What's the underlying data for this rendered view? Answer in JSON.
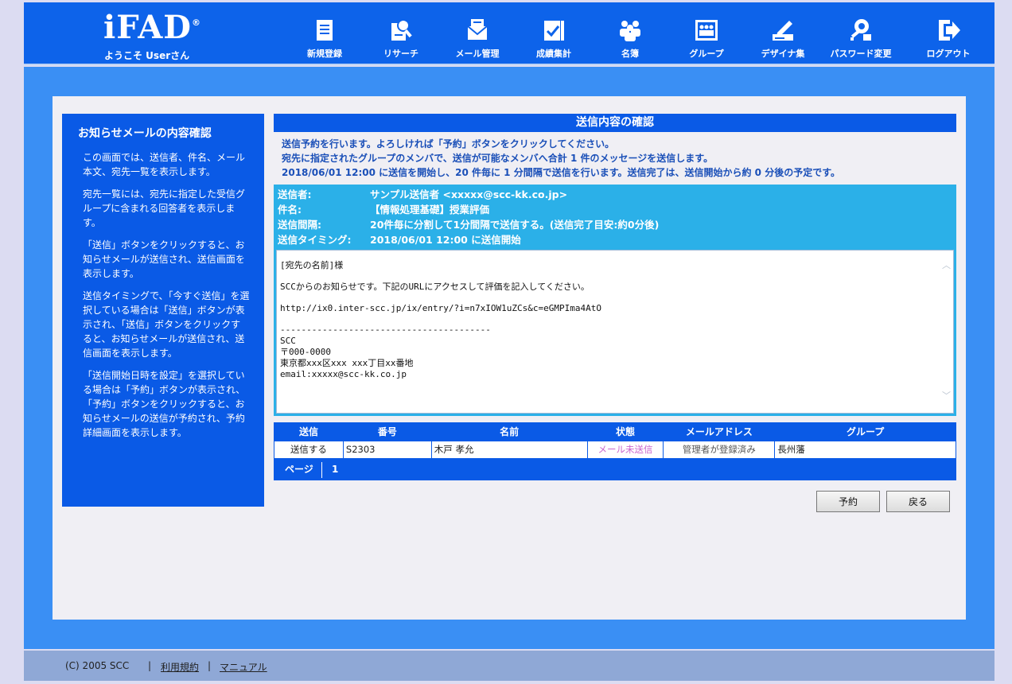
{
  "header": {
    "logo": "iFAD",
    "logo_mark": "®",
    "welcome": "ようこそ Userさん",
    "nav": [
      {
        "label": "新規登録",
        "icon": "document-icon"
      },
      {
        "label": "リサーチ",
        "icon": "research-icon"
      },
      {
        "label": "メール管理",
        "icon": "mail-icon"
      },
      {
        "label": "成績集計",
        "icon": "tally-icon"
      },
      {
        "label": "名簿",
        "icon": "people-icon"
      },
      {
        "label": "グループ",
        "icon": "group-icon"
      },
      {
        "label": "デザイナ集",
        "icon": "designer-icon"
      },
      {
        "label": "パスワード変更",
        "icon": "password-icon"
      },
      {
        "label": "ログアウト",
        "icon": "logout-icon"
      }
    ]
  },
  "sidebar": {
    "title": "お知らせメールの内容確認",
    "paragraphs": [
      "この画面では、送信者、件名、メール本文、宛先一覧を表示します。",
      "宛先一覧には、宛先に指定した受信グループに含まれる回答者を表示します。",
      "「送信」ボタンをクリックすると、お知らせメールが送信され、送信画面を表示します。",
      "送信タイミングで、「今すぐ送信」を選択している場合は「送信」ボタンが表示され、「送信」ボタンをクリックすると、お知らせメールが送信され、送信画面を表示します。",
      "「送信開始日時を設定」を選択している場合は「予約」ボタンが表示され、「予約」ボタンをクリックすると、お知らせメールの送信が予約され、予約詳細画面を表示します。"
    ]
  },
  "main": {
    "title": "送信内容の確認",
    "notice": [
      "送信予約を行います。よろしければ「予約」ボタンをクリックしてください。",
      "宛先に指定されたグループのメンバで、送信が可能なメンバへ合計 1 件のメッセージを送信します。",
      "2018/06/01 12:00 に送信を開始し、20 件毎に 1 分間隔で送信を行います。送信完了は、送信開始から約 0 分後の予定です。"
    ],
    "info": {
      "sender_label": "送信者:",
      "sender_value": "サンプル送信者 <xxxxx@scc-kk.co.jp>",
      "subject_label": "件名:",
      "subject_value": "【情報処理基礎】授業評価",
      "interval_label": "送信間隔:",
      "interval_value": "20件毎に分割して1分間隔で送信する。(送信完了目安:約0分後)",
      "timing_label": "送信タイミング:",
      "timing_value": "2018/06/01 12:00 に送信開始"
    },
    "message": {
      "line1": "[宛先の名前]様",
      "line2": "SCCからのお知らせです。下記のURLにアクセスして評価を記入してください。",
      "line3": "http://ix0.inter-scc.jp/ix/entry/?i=n7xIOW1uZCs&c=eGMPIma4AtO",
      "line4": "----------------------------------------",
      "line5": "SCC",
      "line6": "〒000-0000",
      "line7": "東京都xxx区xxx xxx丁目xx番地",
      "line8": "email:xxxxx@scc-kk.co.jp"
    },
    "table": {
      "headers": [
        "送信",
        "番号",
        "名前",
        "状態",
        "メールアドレス",
        "グループ"
      ],
      "rows": [
        [
          "送信する",
          "S2303",
          "木戸 孝允",
          "メール未送信",
          "管理者が登録済み",
          "長州藩"
        ]
      ]
    },
    "pager": {
      "label": "ページ",
      "current": "1"
    },
    "buttons": {
      "reserve": "予約",
      "back": "戻る"
    }
  },
  "footer": {
    "copyright": "(C) 2005 SCC",
    "sep": "|",
    "terms": "利用規約",
    "manual": "マニュアル"
  },
  "colors": {
    "header_blue": "#0d63ea",
    "band_blue": "#3a8ff4",
    "info_cyan": "#2bb0e8",
    "status_pink": "#cc66cc"
  }
}
